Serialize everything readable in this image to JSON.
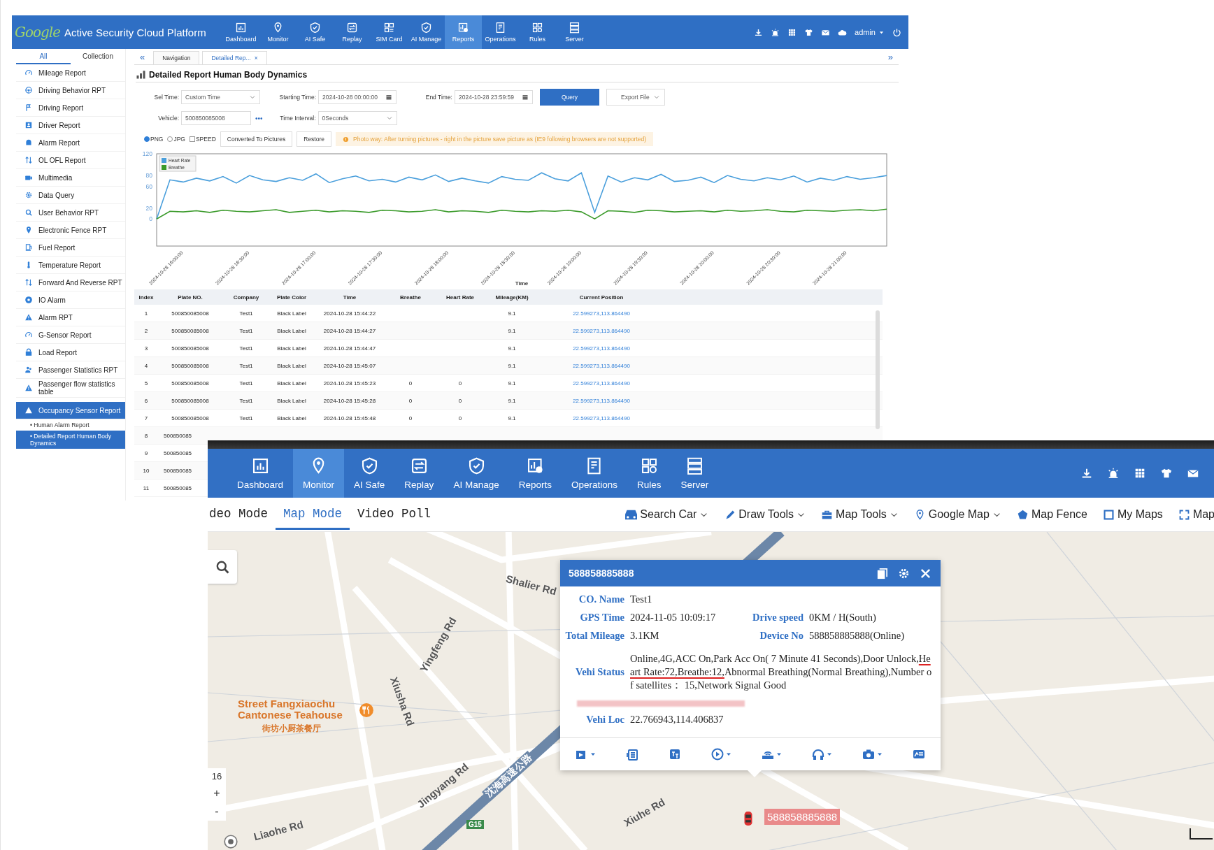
{
  "platform": {
    "logo": "Google",
    "title": "Active Security Cloud Platform",
    "nav": [
      {
        "label": "Dashboard",
        "selected": false
      },
      {
        "label": "Monitor",
        "selected": false
      },
      {
        "label": "AI Safe",
        "selected": false
      },
      {
        "label": "Replay",
        "selected": false
      },
      {
        "label": "SIM Card",
        "selected": false
      },
      {
        "label": "AI Manage",
        "selected": false
      },
      {
        "label": "Reports",
        "selected": true
      },
      {
        "label": "Operations",
        "selected": false
      },
      {
        "label": "Rules",
        "selected": false
      },
      {
        "label": "Server",
        "selected": false
      }
    ],
    "user": "admin",
    "sidebar": {
      "tabs": [
        {
          "label": "All",
          "selected": true
        },
        {
          "label": "Collection",
          "selected": false
        }
      ],
      "items": [
        {
          "label": "Mileage Report",
          "expanded": false
        },
        {
          "label": "Driving Behavior RPT",
          "expanded": false
        },
        {
          "label": "Driving Report",
          "expanded": false
        },
        {
          "label": "Driver Report",
          "expanded": false
        },
        {
          "label": "Alarm Report",
          "expanded": false
        },
        {
          "label": "OL OFL Report",
          "expanded": false
        },
        {
          "label": "Multimedia",
          "expanded": false
        },
        {
          "label": "Data Query",
          "expanded": false
        },
        {
          "label": "User Behavior RPT",
          "expanded": false
        },
        {
          "label": "Electronic Fence RPT",
          "expanded": false
        },
        {
          "label": "Fuel Report",
          "expanded": false
        },
        {
          "label": "Temperature Report",
          "expanded": false
        },
        {
          "label": "Forward And Reverse RPT",
          "expanded": false
        },
        {
          "label": "IO Alarm",
          "expanded": false
        },
        {
          "label": "Alarm RPT",
          "expanded": false
        },
        {
          "label": "G-Sensor Report",
          "expanded": false
        },
        {
          "label": "Load Report",
          "expanded": false
        },
        {
          "label": "Passenger Statistics RPT",
          "expanded": false
        },
        {
          "label": "Passenger flow statistics table",
          "expanded": false
        },
        {
          "label": "Occupancy Sensor Report",
          "expanded": true,
          "children": [
            {
              "label": "• Human Alarm Report",
              "selected": false
            },
            {
              "label": "• Detailed Report Human Body Dynamics",
              "selected": true
            }
          ]
        }
      ]
    },
    "collapse": "«",
    "expand": "»",
    "page_tabs": [
      {
        "label": "Navigation",
        "selected": false
      },
      {
        "label": "Detailed Rep...",
        "selected": true,
        "close": "×"
      }
    ],
    "report": {
      "title": "Detailed Report Human Body Dynamics",
      "sel_time": {
        "label": "Sel Time:",
        "value": "Custom Time"
      },
      "start": {
        "label": "Starting Time:",
        "value": "2024-10-28 00:00:00"
      },
      "end": {
        "label": "End Time:",
        "value": "2024-10-28 23:59:59"
      },
      "query": "Query",
      "export": "Export File",
      "vehicle": {
        "label": "Vehicle:",
        "value": "500850085008",
        "more": "•••"
      },
      "interval": {
        "label": "Time Interval:",
        "value": "0Seconds"
      },
      "options": [
        {
          "kind": "radio",
          "label": "PNG",
          "checked": true
        },
        {
          "kind": "radio",
          "label": "JPG",
          "checked": false
        },
        {
          "kind": "checkbox",
          "label": "SPEED",
          "checked": false
        }
      ],
      "buttons": [
        "Converted To Pictures",
        "Restore"
      ],
      "notice": "Photo way: After turning pictures - right in the picture save picture as (IE9 following browsers are not supported)",
      "chart_data": {
        "type": "line",
        "xlabel": "Time",
        "legend": "top-left",
        "ylim": [
          -50,
          120
        ],
        "yticks": [
          0,
          20,
          60,
          80,
          120
        ],
        "categories": [
          null,
          null,
          "2024-10-28 16:00:00",
          null,
          null,
          null,
          null,
          "2024-10-28 16:30:00",
          null,
          null,
          null,
          null,
          "2024-10-28 17:00:00",
          null,
          null,
          null,
          null,
          "2024-10-28 17:30:00",
          null,
          null,
          null,
          null,
          "2024-10-28 18:00:00",
          null,
          null,
          null,
          null,
          "2024-10-28 18:30:00",
          null,
          null,
          null,
          null,
          "2024-10-28 19:00:00",
          null,
          null,
          null,
          null,
          "2024-10-28 19:30:00",
          null,
          null,
          null,
          null,
          "2024-10-28 20:00:00",
          null,
          null,
          null,
          null,
          "2024-10-28 20:30:00",
          null,
          null,
          null,
          null,
          "2024-10-28 21:00:00",
          null,
          null,
          null
        ],
        "series": [
          {
            "name": "Heart Rate",
            "color": "#4a9fdc",
            "values": [
              0,
              72,
              68,
              75,
              70,
              78,
              66,
              80,
              72,
              69,
              76,
              71,
              83,
              67,
              74,
              79,
              70,
              73,
              68,
              77,
              72,
              81,
              69,
              75,
              70,
              66,
              78,
              73,
              71,
              85,
              74,
              70,
              85,
              12,
              79,
              68,
              76,
              72,
              82,
              69,
              71,
              77,
              67,
              80,
              73,
              70,
              76,
              72,
              79,
              68,
              75,
              71,
              78,
              73,
              76,
              80
            ]
          },
          {
            "name": "Breathe",
            "color": "#3a9a2a",
            "values": [
              0,
              14,
              13,
              15,
              12,
              16,
              14,
              13,
              15,
              17,
              12,
              14,
              16,
              13,
              15,
              14,
              12,
              16,
              15,
              13,
              14,
              17,
              13,
              15,
              14,
              12,
              16,
              14,
              13,
              15,
              14,
              16,
              13,
              0,
              15,
              14,
              12,
              16,
              15,
              13,
              14,
              15,
              13,
              16,
              14,
              15,
              17,
              14,
              13,
              16,
              15,
              14,
              16,
              17,
              15,
              18
            ]
          }
        ]
      },
      "table": {
        "columns": [
          "Index",
          "Plate NO.",
          "Company",
          "Plate Color",
          "Time",
          "Breathe",
          "Heart Rate",
          "Mileage(KM)",
          "Current Position"
        ],
        "rows": [
          [
            "1",
            "500850085008",
            "Test1",
            "Black Label",
            "2024-10-28 15:44:22",
            "",
            "",
            "9.1",
            "22.599273,113.864490"
          ],
          [
            "2",
            "500850085008",
            "Test1",
            "Black Label",
            "2024-10-28 15:44:27",
            "",
            "",
            "9.1",
            "22.599273,113.864490"
          ],
          [
            "3",
            "500850085008",
            "Test1",
            "Black Label",
            "2024-10-28 15:44:47",
            "",
            "",
            "9.1",
            "22.599273,113.864490"
          ],
          [
            "4",
            "500850085008",
            "Test1",
            "Black Label",
            "2024-10-28 15:45:07",
            "",
            "",
            "9.1",
            "22.599273,113.864490"
          ],
          [
            "5",
            "500850085008",
            "Test1",
            "Black Label",
            "2024-10-28 15:45:23",
            "0",
            "0",
            "9.1",
            "22.599273,113.864490"
          ],
          [
            "6",
            "500850085008",
            "Test1",
            "Black Label",
            "2024-10-28 15:45:28",
            "0",
            "0",
            "9.1",
            "22.599273,113.864490"
          ],
          [
            "7",
            "500850085008",
            "Test1",
            "Black Label",
            "2024-10-28 15:45:48",
            "0",
            "0",
            "9.1",
            "22.599273,113.864490"
          ],
          [
            "8",
            "500850085"
          ],
          [
            "9",
            "500850085"
          ],
          [
            "10",
            "500850085"
          ],
          [
            "11",
            "500850085"
          ]
        ]
      }
    }
  },
  "monitor": {
    "nav": [
      {
        "label": "Dashboard",
        "selected": false
      },
      {
        "label": "Monitor",
        "selected": true
      },
      {
        "label": "AI Safe",
        "selected": false
      },
      {
        "label": "Replay",
        "selected": false
      },
      {
        "label": "AI Manage",
        "selected": false
      },
      {
        "label": "Reports",
        "selected": false
      },
      {
        "label": "Operations",
        "selected": false
      },
      {
        "label": "Rules",
        "selected": false
      },
      {
        "label": "Server",
        "selected": false
      }
    ],
    "view_tabs": [
      {
        "label": "deo Mode",
        "selected": false
      },
      {
        "label": "Map Mode",
        "selected": true
      },
      {
        "label": "Video Poll",
        "selected": false
      }
    ],
    "tools": [
      {
        "label": "Search Car",
        "dropdown": true
      },
      {
        "label": "Draw Tools",
        "dropdown": true
      },
      {
        "label": "Map Tools",
        "dropdown": true
      },
      {
        "label": "Google Map",
        "dropdown": true
      },
      {
        "label": "Map Fence",
        "dropdown": false
      },
      {
        "label": "My Maps",
        "dropdown": false
      },
      {
        "label": "Map",
        "dropdown": false
      }
    ],
    "map": {
      "labels": [
        "Shalier Rd",
        "Yingfeng Rd",
        "Xiusha Rd",
        "Jingyang Rd",
        "沈海高速公路",
        "G15",
        "Liaohe Rd",
        "Xiuhe Rd",
        "Street Fangxiaochu Cantonese Teahouse",
        "街坊小厨茶餐厅"
      ],
      "zoom": "16",
      "zoom_in": "+",
      "zoom_out": "-"
    },
    "popup": {
      "title": "588858885888",
      "fields": [
        [
          {
            "label": "CO. Name",
            "value": "Test1"
          }
        ],
        [
          {
            "label": "GPS Time",
            "value": "2024-11-05 10:09:17"
          },
          {
            "label": "Drive speed",
            "value": "0KM / H(South)"
          }
        ],
        [
          {
            "label": "Total Mileage",
            "value": "3.1KM"
          },
          {
            "label": "Device No",
            "value": "588858885888(Online)"
          }
        ]
      ],
      "status": {
        "label": "Vehi Status",
        "before": "Online,4G,ACC On,Park Acc On( 7 Minute 41 Seconds),Door Unlock,",
        "highlight": "Heart Rate:72,Breathe:12,",
        "after": "Abnormal Breathing(Normal Breathing),Number of satellites：  15,Network Signal Good"
      },
      "location": {
        "label": "Vehi Loc",
        "value": "22.766943,114.406837"
      }
    },
    "marker_label": "588858885888"
  }
}
